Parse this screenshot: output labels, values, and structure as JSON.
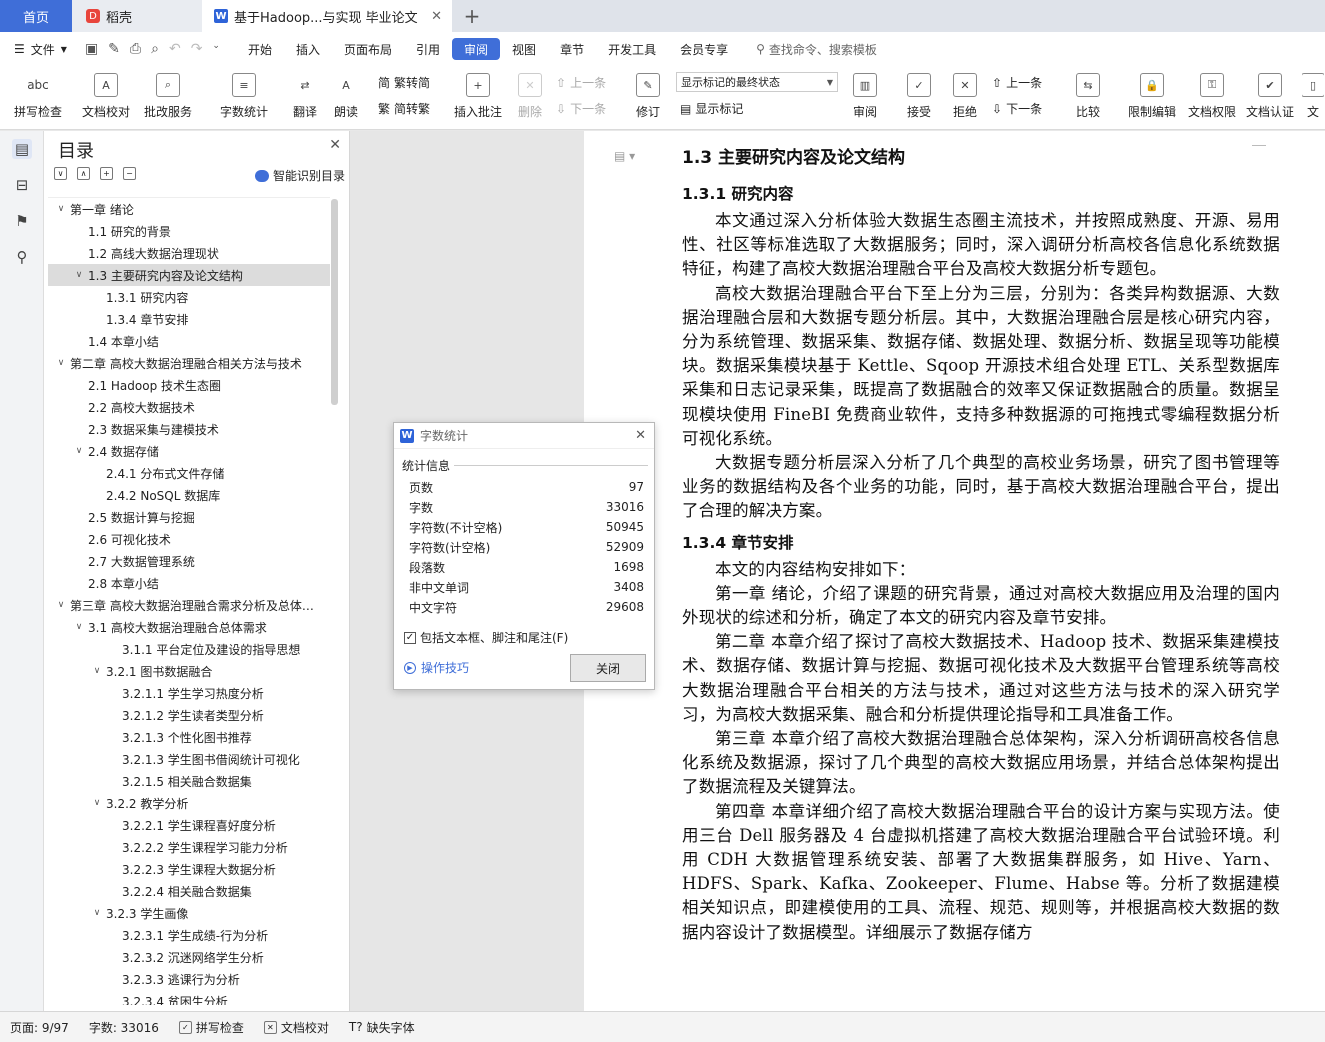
{
  "tabs": {
    "home": "首页",
    "daoke": "稻壳",
    "doc": "基于Hadoop...与实现 毕业论文",
    "close": "✕",
    "add": "+"
  },
  "menu": {
    "file": "文件",
    "items": [
      "开始",
      "插入",
      "页面布局",
      "引用",
      "审阅",
      "视图",
      "章节",
      "开发工具",
      "会员专享"
    ],
    "search": "查找命令、搜索模板"
  },
  "ribbon": {
    "spell": "拼写检查",
    "doccheck": "文档校对",
    "annot_service": "批改服务",
    "wordcount": "字数统计",
    "translate": "翻译",
    "read": "朗读",
    "trad": "繁转简",
    "simp": "简转繁",
    "insert_comment": "插入批注",
    "delete": "删除",
    "prev1": "上一条",
    "next1": "下一条",
    "revise": "修订",
    "display_select": "显示标记的最终状态",
    "show_marks": "显示标记",
    "review": "审阅",
    "accept": "接受",
    "reject": "拒绝",
    "prev2": "上一条",
    "next2": "下一条",
    "compare": "比较",
    "limit_edit": "限制编辑",
    "doc_perm": "文档权限",
    "doc_auth": "文档认证",
    "more": "文"
  },
  "toc": {
    "title": "目录",
    "smart": "智能识别目录",
    "items": [
      {
        "label": "第一章  绪论",
        "level": 0,
        "toggle": "∨"
      },
      {
        "label": "1.1  研究的背景",
        "level": 1,
        "toggle": ""
      },
      {
        "label": "1.2  高线大数据治理现状",
        "level": 1,
        "toggle": ""
      },
      {
        "label": "1.3  主要研究内容及论文结构",
        "level": 1,
        "toggle": "∨",
        "selected": true
      },
      {
        "label": "1.3.1  研究内容",
        "level": 2,
        "toggle": ""
      },
      {
        "label": "1.3.4  章节安排",
        "level": 2,
        "toggle": ""
      },
      {
        "label": "1.4  本章小结",
        "level": 1,
        "toggle": ""
      },
      {
        "label": "第二章  高校大数据治理融合相关方法与技术",
        "level": 0,
        "toggle": "∨"
      },
      {
        "label": "2.1 Hadoop 技术生态圈",
        "level": 1,
        "toggle": ""
      },
      {
        "label": "2.2 高校大数据技术",
        "level": 1,
        "toggle": ""
      },
      {
        "label": "2.3  数据采集与建模技术",
        "level": 1,
        "toggle": ""
      },
      {
        "label": "2.4  数据存储",
        "level": 1,
        "toggle": "∨"
      },
      {
        "label": "2.4.1  分布式文件存储",
        "level": 2,
        "toggle": ""
      },
      {
        "label": "2.4.2 NoSQL 数据库",
        "level": 2,
        "toggle": ""
      },
      {
        "label": "2.5  数据计算与挖掘",
        "level": 1,
        "toggle": ""
      },
      {
        "label": "2.6  可视化技术",
        "level": 1,
        "toggle": ""
      },
      {
        "label": "2.7 大数据管理系统",
        "level": 1,
        "toggle": ""
      },
      {
        "label": "2.8  本章小结",
        "level": 1,
        "toggle": ""
      },
      {
        "label": "第三章  高校大数据治理融合需求分析及总体…",
        "level": 0,
        "toggle": "∨"
      },
      {
        "label": "3.1  高校大数据治理融合总体需求",
        "level": 1,
        "toggle": "∨"
      },
      {
        "label": "3.1.1  平台定位及建设的指导思想",
        "level": 3,
        "toggle": ""
      },
      {
        "label": "3.2.1  图书数据融合",
        "level": 2,
        "toggle": "∨"
      },
      {
        "label": "3.2.1.1 学生学习热度分析",
        "level": 3,
        "toggle": ""
      },
      {
        "label": "3.2.1.2  学生读者类型分析",
        "level": 3,
        "toggle": ""
      },
      {
        "label": "3.2.1.3  个性化图书推荐",
        "level": 3,
        "toggle": ""
      },
      {
        "label": "3.2.1.3 学生图书借阅统计可视化",
        "level": 3,
        "toggle": ""
      },
      {
        "label": "3.2.1.5 相关融合数据集",
        "level": 3,
        "toggle": ""
      },
      {
        "label": "3.2.2  教学分析",
        "level": 2,
        "toggle": "∨"
      },
      {
        "label": "3.2.2.1  学生课程喜好度分析",
        "level": 3,
        "toggle": ""
      },
      {
        "label": "3.2.2.2  学生课程学习能力分析",
        "level": 3,
        "toggle": ""
      },
      {
        "label": "3.2.2.3  学生课程大数据分析",
        "level": 3,
        "toggle": ""
      },
      {
        "label": "3.2.2.4 相关融合数据集",
        "level": 3,
        "toggle": ""
      },
      {
        "label": "3.2.3  学生画像",
        "level": 2,
        "toggle": "∨"
      },
      {
        "label": "3.2.3.1  学生成绩-行为分析",
        "level": 3,
        "toggle": ""
      },
      {
        "label": "3.2.3.2  沉迷网络学生分析",
        "level": 3,
        "toggle": ""
      },
      {
        "label": "3.2.3.3  逃课行为分析",
        "level": 3,
        "toggle": ""
      },
      {
        "label": "3.2.3.4  贫困生分析",
        "level": 3,
        "toggle": ""
      }
    ]
  },
  "doc": {
    "h_13": "1.3  主要研究内容及论文结构",
    "h_131": "1.3.1  研究内容",
    "p1": "本文通过深入分析体验大数据生态圈主流技术，并按照成熟度、开源、易用性、社区等标准选取了大数据服务；同时，深入调研分析高校各信息化系统数据特征，构建了高校大数据治理融合平台及高校大数据分析专题包。",
    "p2": "高校大数据治理融合平台下至上分为三层，分别为：各类异构数据源、大数据治理融合层和大数据专题分析层。其中，大数据治理融合层是核心研究内容，分为系统管理、数据采集、数据存储、数据处理、数据分析、数据呈现等功能模块。数据采集模块基于 Kettle、Sqoop 开源技术组合处理 ETL、关系型数据库采集和日志记录采集，既提高了数据融合的效率又保证数据融合的质量。数据呈现模块使用 FineBI 免费商业软件，支持多种数据源的可拖拽式零编程数据分析可视化系统。",
    "p3": "大数据专题分析层深入分析了几个典型的高校业务场景，研究了图书管理等业务的数据结构及各个业务的功能，同时，基于高校大数据治理融合平台，提出了合理的解决方案。",
    "h_134": "1.3.4  章节安排",
    "p4": "本文的内容结构安排如下：",
    "p5": "第一章  绪论，介绍了课题的研究背景，通过对高校大数据应用及治理的国内外现状的综述和分析，确定了本文的研究内容及章节安排。",
    "p6": "第二章  本章介绍了探讨了高校大数据技术、Hadoop 技术、数据采集建模技术、数据存储、数据计算与挖掘、数据可视化技术及大数据平台管理系统等高校大数据治理融合平台相关的方法与技术，通过对这些方法与技术的深入研究学习，为高校大数据采集、融合和分析提供理论指导和工具准备工作。",
    "p7": "第三章  本章介绍了高校大数据治理融合总体架构，深入分析调研高校各信息化系统及数据源，探讨了几个典型的高校大数据应用场景，并结合总体架构提出了数据流程及关键算法。",
    "p8": "第四章  本章详细介绍了高校大数据治理融合平台的设计方案与实现方法。使用三台 Dell 服务器及 4 台虚拟机搭建了高校大数据治理融合平台试验环境。利用 CDH 大数据管理系统安装、部署了大数据集群服务，如 Hive、Yarn、HDFS、Spark、Kafka、Zookeeper、Flume、Habse 等。分析了数据建模相关知识点，即建模使用的工具、流程、规范、规则等，并根据高校大数据的数据内容设计了数据模型。详细展示了数据存储方"
  },
  "dialog": {
    "title": "字数统计",
    "section": "统计信息",
    "rows": [
      {
        "label": "页数",
        "value": "97"
      },
      {
        "label": "字数",
        "value": "33016"
      },
      {
        "label": "字符数(不计空格)",
        "value": "50945"
      },
      {
        "label": "字符数(计空格)",
        "value": "52909"
      },
      {
        "label": "段落数",
        "value": "1698"
      },
      {
        "label": "非中文单词",
        "value": "3408"
      },
      {
        "label": "中文字符",
        "value": "29608"
      }
    ],
    "include": "包括文本框、脚注和尾注(F)",
    "tips": "操作技巧",
    "close": "关闭"
  },
  "status": {
    "page": "页面: 9/97",
    "words": "字数: 33016",
    "spell": "拼写检查",
    "check": "文档校对",
    "font": "缺失字体"
  },
  "colors": {
    "accent": "#3f6ed8",
    "tab_bg": "#dfe3ea"
  }
}
